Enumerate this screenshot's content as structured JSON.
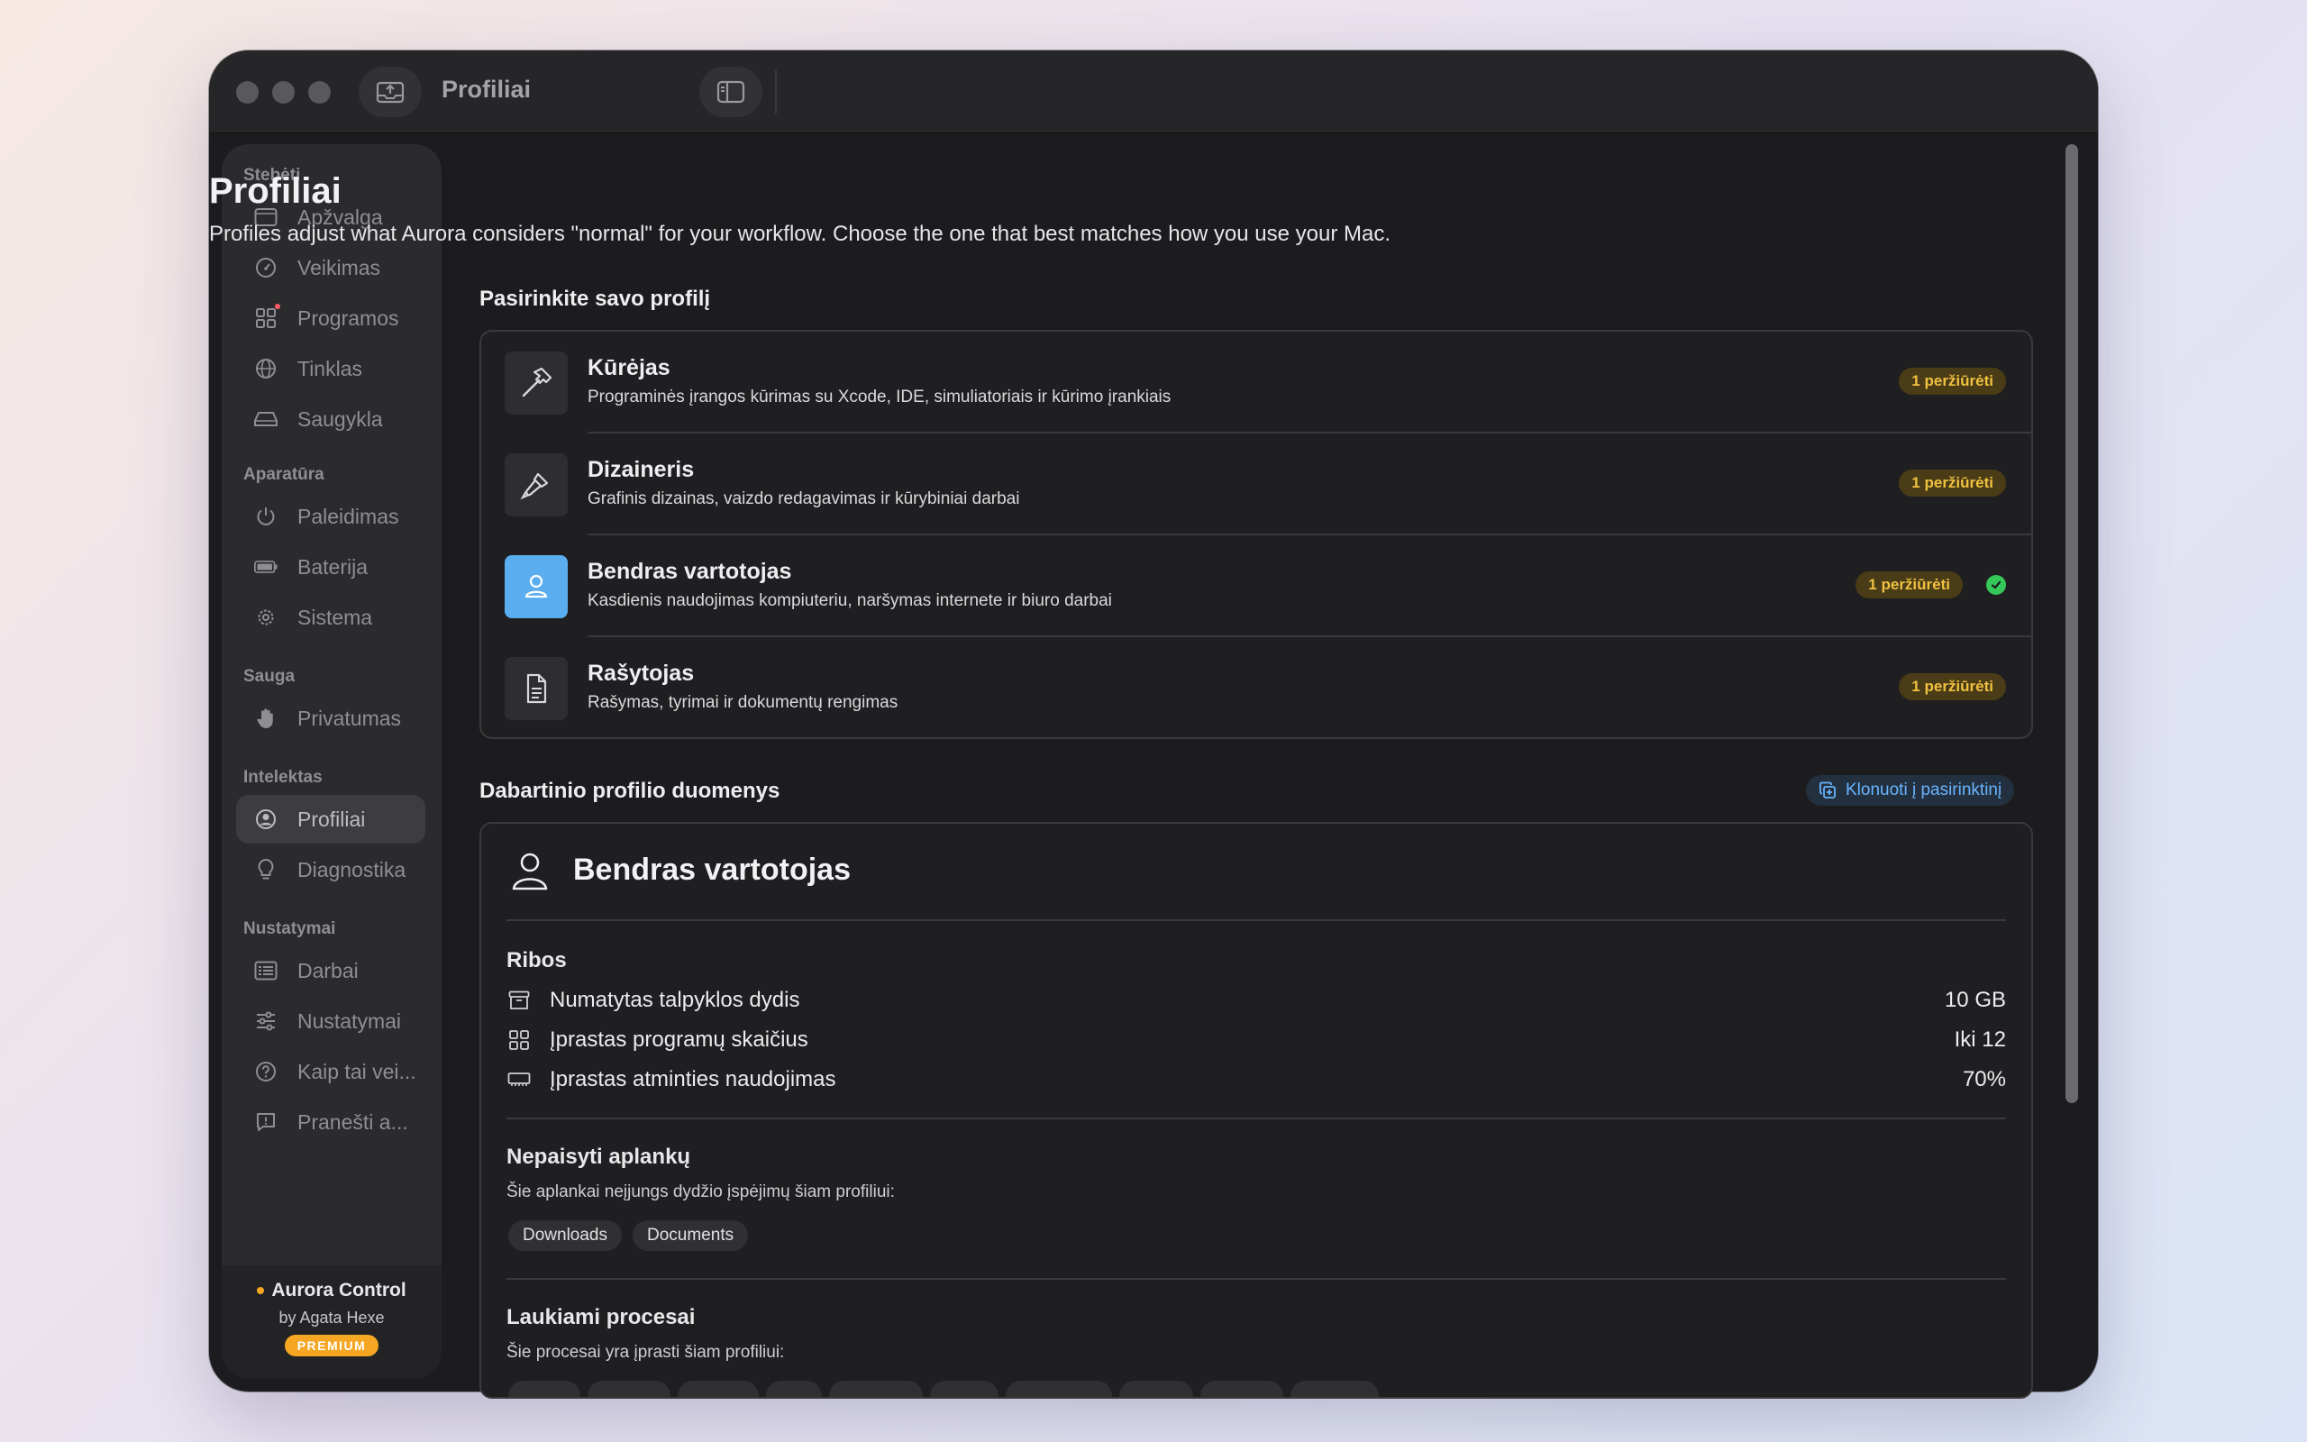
{
  "window": {
    "title": "Profiliai"
  },
  "sidebar": {
    "sections": [
      {
        "title": "Stebėti",
        "items": [
          "Apžvalga",
          "Veikimas",
          "Programos",
          "Tinklas",
          "Saugykla"
        ]
      },
      {
        "title": "Aparatūra",
        "items": [
          "Paleidimas",
          "Baterija",
          "Sistema"
        ]
      },
      {
        "title": "Sauga",
        "items": [
          "Privatumas"
        ]
      },
      {
        "title": "Intelektas",
        "items": [
          "Profiliai",
          "Diagnostika"
        ]
      },
      {
        "title": "Nustatymai",
        "items": [
          "Darbai",
          "Nustatymai",
          "Kaip tai vei...",
          "Pranešti a..."
        ]
      }
    ],
    "active_item": "Profiliai",
    "footer": {
      "app_name": "Aurora Control",
      "author": "by Agata Hexe",
      "badge": "PREMIUM"
    }
  },
  "page": {
    "title": "Profiliai",
    "subtitle": "Profiles adjust what Aurora considers \"normal\" for your workflow. Choose the one that best matches how you use your Mac.",
    "choose_heading": "Pasirinkite savo profilį",
    "profiles": [
      {
        "name": "Kūrėjas",
        "desc": "Programinės įrangos kūrimas su Xcode, IDE, simuliatoriais ir kūrimo įrankiais",
        "badge": "1 peržiūrėti",
        "icon": "hammer-icon",
        "selected": false
      },
      {
        "name": "Dizaineris",
        "desc": "Grafinis dizainas, vaizdo redagavimas ir kūrybiniai darbai",
        "badge": "1 peržiūrėti",
        "icon": "paintbrush-icon",
        "selected": false
      },
      {
        "name": "Bendras vartotojas",
        "desc": "Kasdienis naudojimas kompiuteriu, naršymas internete ir biuro darbai",
        "badge": "1 peržiūrėti",
        "icon": "person-icon",
        "selected": true
      },
      {
        "name": "Rašytojas",
        "desc": "Rašymas, tyrimai ir dokumentų rengimas",
        "badge": "1 peržiūrėti",
        "icon": "document-icon",
        "selected": false
      }
    ],
    "current_heading": "Dabartinio profilio duomenys",
    "clone_label": "Klonuoti į pasirinktinį",
    "current": {
      "name": "Bendras vartotojas",
      "limits_heading": "Ribos",
      "limits": [
        {
          "label": "Numatytas talpyklos dydis",
          "value": "10 GB",
          "icon": "archive-icon"
        },
        {
          "label": "Įprastas programų skaičius",
          "value": "Iki 12",
          "icon": "grid-icon"
        },
        {
          "label": "Įprastas atminties naudojimas",
          "value": "70%",
          "icon": "memory-icon"
        }
      ],
      "ignore_heading": "Nepaisyti aplankų",
      "ignore_desc": "Šie aplankai neįjungs dydžio įspėjimų šiam profiliui:",
      "ignore_folders": [
        "Downloads",
        "Documents"
      ],
      "expected_heading": "Laukiami procesai",
      "expected_desc": "Šie procesai yra įprasti šiam profiliui:"
    }
  },
  "colors": {
    "accent": "#5aaef0",
    "badge_text": "#f0c040",
    "check": "#34c759",
    "premium": "#f5a623"
  }
}
